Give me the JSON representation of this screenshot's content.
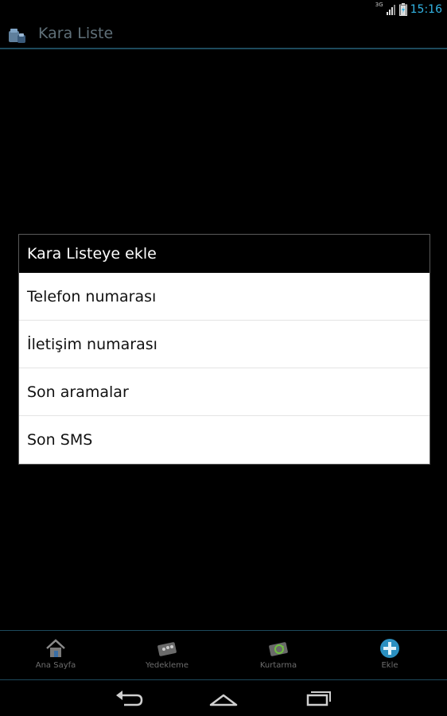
{
  "status": {
    "time": "15:16",
    "network_label": "3G"
  },
  "app": {
    "title": "Kara Liste"
  },
  "dialog": {
    "title": "Kara Listeye ekle",
    "items": [
      "Telefon numarası",
      "İletişim numarası",
      "Son aramalar",
      "Son SMS"
    ]
  },
  "tabs": [
    {
      "label": "Ana Sayfa",
      "icon": "home-icon"
    },
    {
      "label": "Yedekleme",
      "icon": "backup-icon"
    },
    {
      "label": "Kurtarma",
      "icon": "restore-icon"
    },
    {
      "label": "Ekle",
      "icon": "add-icon"
    }
  ],
  "nav": {
    "icons": [
      "back-icon",
      "home-icon",
      "recent-apps-icon"
    ]
  },
  "colors": {
    "accent": "#33b5e5",
    "divider": "#1d4a5c"
  }
}
